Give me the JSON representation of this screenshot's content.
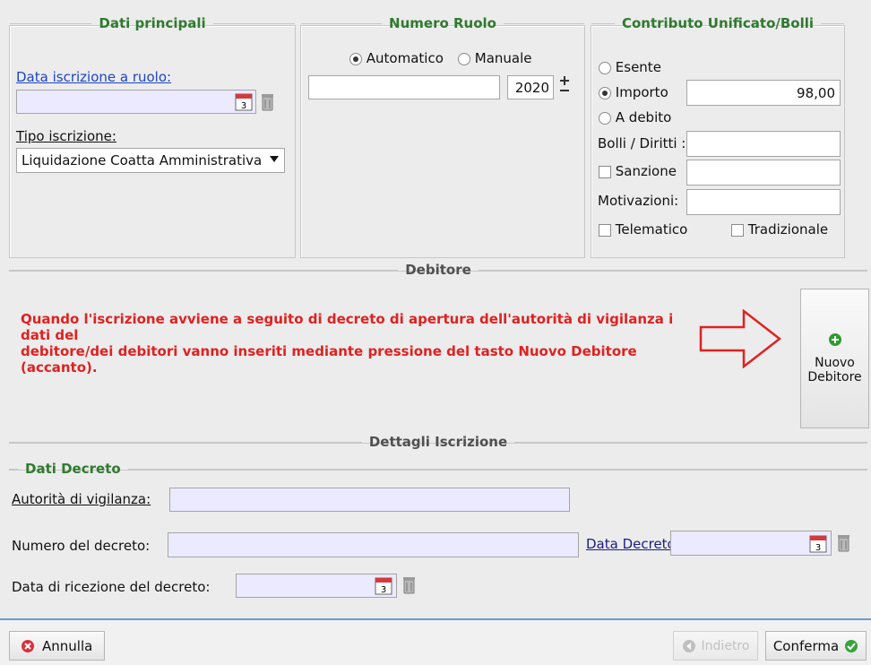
{
  "dati_principali": {
    "title": "Dati principali",
    "data_iscrizione_label": "Data iscrizione a ruolo:",
    "calendar_day": "3",
    "tipo_iscrizione_label": "Tipo iscrizione:",
    "tipo_iscrizione_value": "Liquidazione Coatta Amministrativa"
  },
  "numero_ruolo": {
    "title": "Numero Ruolo",
    "automatico_label": "Automatico",
    "manuale_label": "Manuale",
    "selected": "Automatico",
    "numero_value": "",
    "anno_value": "2020"
  },
  "contributo": {
    "title": "Contributo Unificato/Bolli",
    "esente_label": "Esente",
    "importo_label": "Importo",
    "importo_value": "98,00",
    "a_debito_label": "A debito",
    "selected": "Importo",
    "bolli_label": "Bolli / Diritti :",
    "sanzione_label": "Sanzione",
    "motivazioni_label": "Motivazioni:",
    "telematico_label": "Telematico",
    "tradizionale_label": "Tradizionale"
  },
  "debitore": {
    "title": "Debitore",
    "message_line1": "Quando l'iscrizione avviene a seguito di decreto di apertura dell'autorità di vigilanza i dati del",
    "message_line2": "debitore/dei debitori vanno inseriti mediante pressione del tasto Nuovo Debitore (accanto).",
    "nuovo_line1": "Nuovo",
    "nuovo_line2": "Debitore"
  },
  "dettagli": {
    "title": "Dettagli Iscrizione",
    "dati_decreto_title": "Dati Decreto",
    "autorita_label": "Autorità di vigilanza:",
    "numero_decreto_label": "Numero del decreto:",
    "data_decreto_label": "Data Decreto:",
    "data_ricezione_label": "Data di ricezione del decreto:",
    "calendar_day": "3"
  },
  "footer": {
    "annulla_label": "Annulla",
    "indietro_label": "Indietro",
    "conferma_label": "Conferma"
  },
  "colors": {
    "accent_green": "#2f7a2f",
    "warning_red": "#e02121",
    "link_blue": "#1c44c9",
    "field_lavender": "#ebeaff"
  }
}
